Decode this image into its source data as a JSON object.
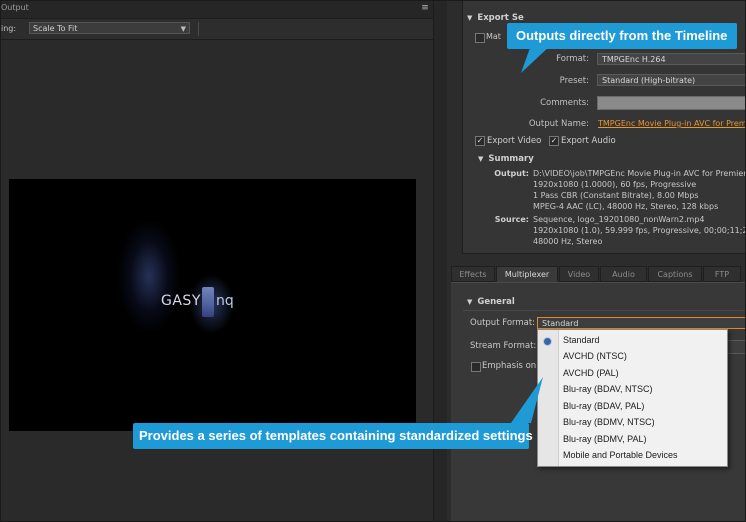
{
  "left": {
    "tab_label": "Output",
    "menu_glyph": "≡",
    "scale_label": "ing:",
    "scale_value": "Scale To Fit",
    "preview": {
      "logo_text": "GASY",
      "logo_tail": "nq"
    }
  },
  "export": {
    "header": "Export Se",
    "match_label": "Mat",
    "format_label": "Format:",
    "format_value": "TMPGEnc H.264",
    "preset_label": "Preset:",
    "preset_value": "Standard (High-bitrate)",
    "comments_label": "Comments:",
    "output_name_label": "Output Name:",
    "output_name_value": "TMPGEnc Movie Plug-in AVC for Premiere",
    "export_video_label": "Export Video",
    "export_audio_label": "Export Audio",
    "summary_title": "Summary",
    "output_key": "Output:",
    "output_lines": [
      "D:\\VIDEO\\job\\TMPGEnc Movie Plug-in AVC for Premiere",
      "1920x1080 (1.0000), 60 fps, Progressive",
      "1 Pass CBR (Constant Bitrate), 8.00 Mbps",
      "MPEG-4 AAC (LC), 48000 Hz, Stereo, 128 kbps"
    ],
    "source_key": "Source:",
    "source_lines": [
      "Sequence, logo_19201080_nonWarn2.mp4",
      "1920x1080 (1.0), 59.999 fps, Progressive, 00;00;11;29",
      "48000 Hz, Stereo"
    ]
  },
  "tabs": [
    "Effects",
    "Multiplexer",
    "Video",
    "Audio",
    "Captions",
    "FTP"
  ],
  "active_tab": "Multiplexer",
  "general": {
    "title": "General",
    "output_format_label": "Output Format:",
    "output_format_value": "Standard",
    "stream_format_label": "Stream Format:",
    "emphasis_label": "Emphasis on p"
  },
  "dropdown_options": [
    "Standard",
    "AVCHD (NTSC)",
    "AVCHD (PAL)",
    "Blu-ray (BDAV, NTSC)",
    "Blu-ray (BDAV, PAL)",
    "Blu-ray (BDMV, NTSC)",
    "Blu-ray (BDMV, PAL)",
    "Mobile and Portable Devices"
  ],
  "callouts": {
    "top": "Outputs directly from the Timeline",
    "bottom": "Provides a series of templates containing standardized settings"
  },
  "colors": {
    "callout": "#1e9ad6",
    "link": "#e8962e",
    "focus": "#e08a2a"
  }
}
